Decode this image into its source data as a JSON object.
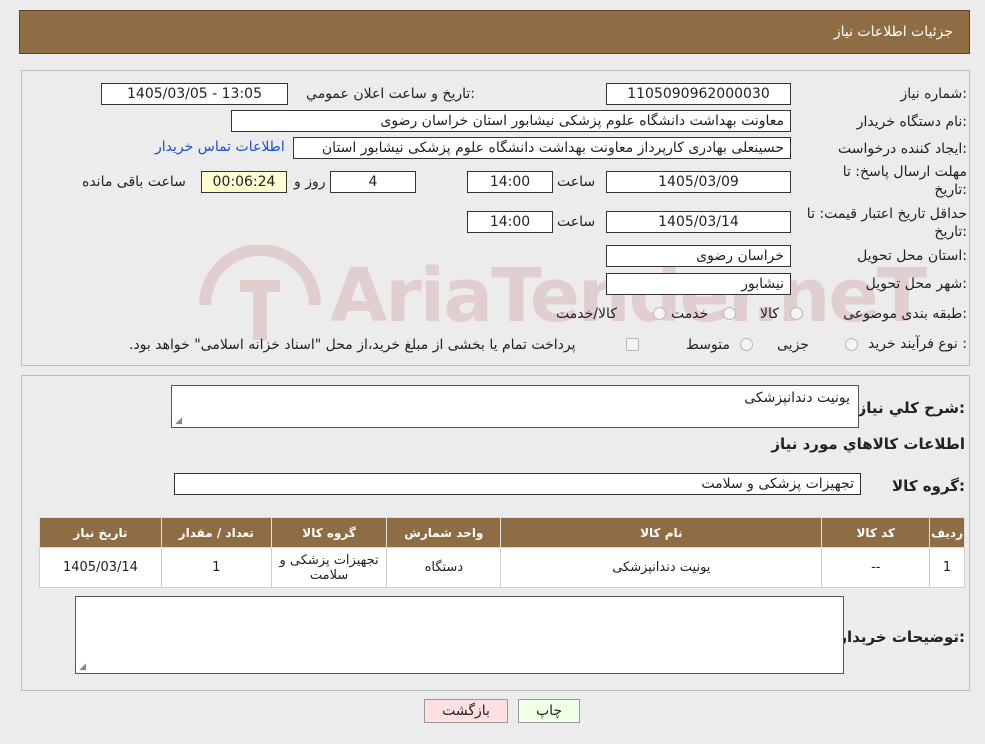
{
  "header": {
    "title": "جزئیات اطلاعات نیاز"
  },
  "form": {
    "need_number_label": "شماره نیاز:",
    "need_number": "1105090962000030",
    "announce_label": "تاریخ و ساعت اعلان عمومي:",
    "announce_value": "1405/03/05 - 13:05",
    "buyer_org_label": "نام دستگاه خریدار:",
    "buyer_org": "معاونت بهداشت دانشگاه علوم پزشکی نیشابور استان خراسان رضوی",
    "creator_label": "ایجاد کننده درخواست:",
    "creator": "حسینعلی بهادری کارپرداز معاونت بهداشت دانشگاه علوم پزشکی نیشابور استان",
    "contact_link": "اطلاعات تماس خریدار",
    "deadline_label_1": "مهلت ارسال پاسخ: تا",
    "deadline_label_2": "تاریخ:",
    "deadline_date": "1405/03/09",
    "time_label": "ساعت",
    "deadline_time": "14:00",
    "days_value": "4",
    "days_label": "روز و",
    "remaining_value": "00:06:24",
    "remaining_label": "ساعت باقی مانده",
    "validity_label_1": "حداقل تاریخ اعتبار قیمت: تا",
    "validity_label_2": "تاریخ:",
    "validity_date": "1405/03/14",
    "validity_time": "14:00",
    "province_label": "استان محل تحویل:",
    "province": "خراسان رضوی",
    "city_label": "شهر محل تحویل:",
    "city": "نیشابور",
    "category_label": "طبقه بندی موضوعی:",
    "category_options": [
      "کالا",
      "خدمت",
      "کالا/خدمت"
    ],
    "process_label": "نوع فرآیند خرید :",
    "process_options": [
      "جزیی",
      "متوسط"
    ],
    "process_note": "پرداخت تمام یا بخشی از مبلغ خرید،از محل \"اسناد خزانه اسلامی\" خواهد بود."
  },
  "summary": {
    "desc_label": "شرح کلي نیاز:",
    "desc_value": "یونیت دندانپزشکی",
    "goods_info_title": "اطلاعات کالاهاي مورد نیاز",
    "group_label": "گروه کالا:",
    "group_value": "تجهیزات پزشکی و سلامت",
    "table_headers": [
      "ردیف",
      "کد کالا",
      "نام کالا",
      "واحد شمارش",
      "گروه کالا",
      "تعداد / مقدار",
      "تاریخ نیاز"
    ],
    "table_rows": [
      [
        "1",
        "--",
        "یونیت دندانپزشکی",
        "دستگاه",
        "تجهیزات پزشکی و سلامت",
        "1",
        "1405/03/14"
      ]
    ],
    "buyer_notes_label": "توضیحات خریدار:",
    "buyer_notes_value": ""
  },
  "buttons": {
    "print": "چاپ",
    "back": "بازگشت"
  },
  "watermark": "AriaTender.neT"
}
